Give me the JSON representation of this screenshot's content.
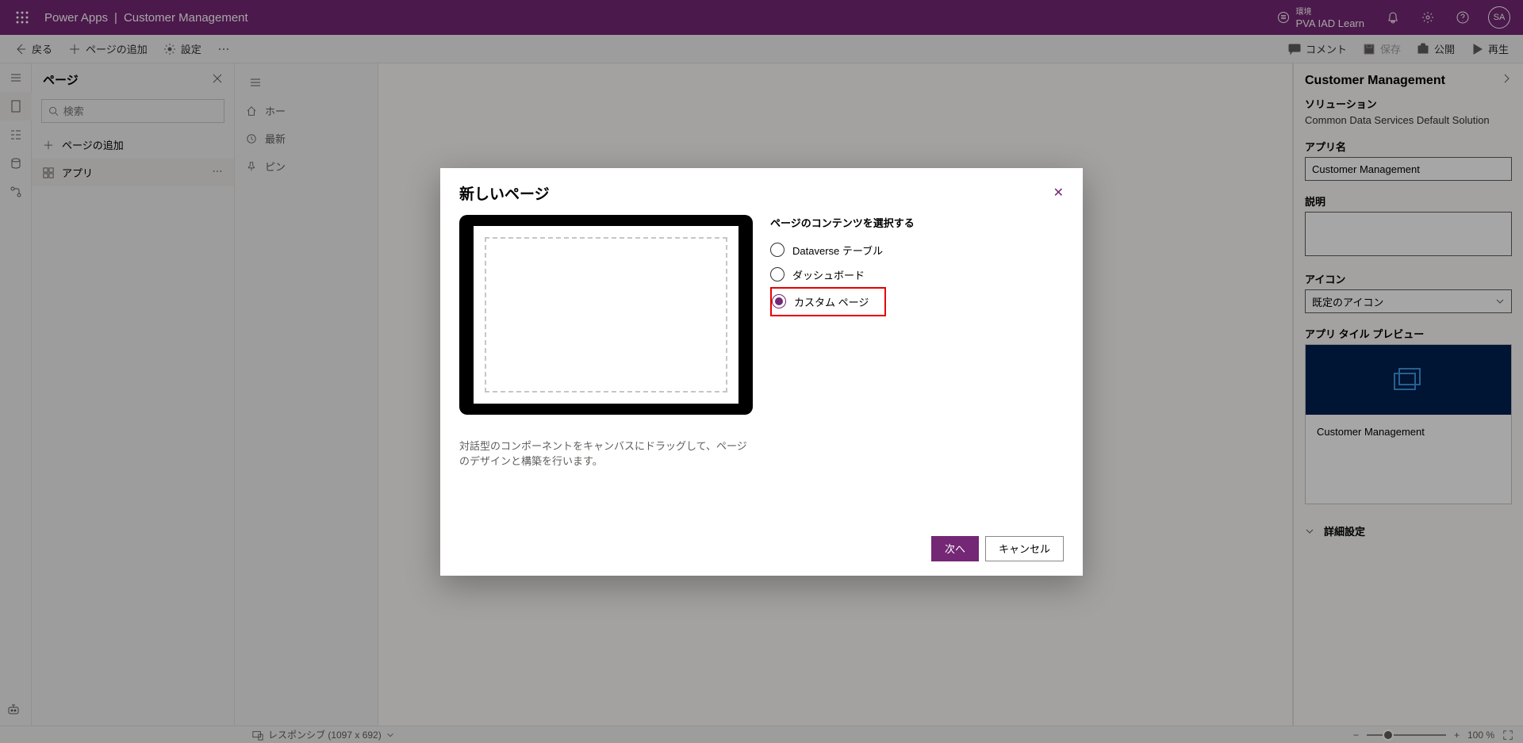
{
  "header": {
    "product": "Power Apps",
    "appName": "Customer Management",
    "envLabel": "環境",
    "envName": "PVA IAD Learn",
    "userInitials": "SA"
  },
  "commandbar": {
    "back": "戻る",
    "addPage": "ページの追加",
    "settings": "設定",
    "comment": "コメント",
    "save": "保存",
    "publish": "公開",
    "play": "再生"
  },
  "tree": {
    "title": "ページ",
    "searchPlaceholder": "検索",
    "addPage": "ページの追加",
    "items": [
      {
        "label": "アプリ"
      }
    ]
  },
  "canvasNav": {
    "home": "ホー",
    "recent": "最新",
    "pinned": "ピン"
  },
  "props": {
    "title": "Customer Management",
    "solutionLabel": "ソリューション",
    "solutionValue": "Common Data Services Default Solution",
    "appNameLabel": "アプリ名",
    "appNameValue": "Customer Management",
    "descLabel": "説明",
    "iconLabel": "アイコン",
    "iconValue": "既定のアイコン",
    "tilePreviewLabel": "アプリ タイル プレビュー",
    "tileName": "Customer Management",
    "detailsLabel": "詳細設定"
  },
  "statusbar": {
    "responsive": "レスポンシブ (1097 x 692)",
    "zoom": "100 %"
  },
  "modal": {
    "title": "新しいページ",
    "optionsTitle": "ページのコンテンツを選択する",
    "options": [
      {
        "label": "Dataverse テーブル",
        "selected": false
      },
      {
        "label": "ダッシュボード",
        "selected": false
      },
      {
        "label": "カスタム ページ",
        "selected": true,
        "highlight": true
      }
    ],
    "description": "対話型のコンポーネントをキャンバスにドラッグして、ページのデザインと構築を行います。",
    "next": "次へ",
    "cancel": "キャンセル"
  }
}
